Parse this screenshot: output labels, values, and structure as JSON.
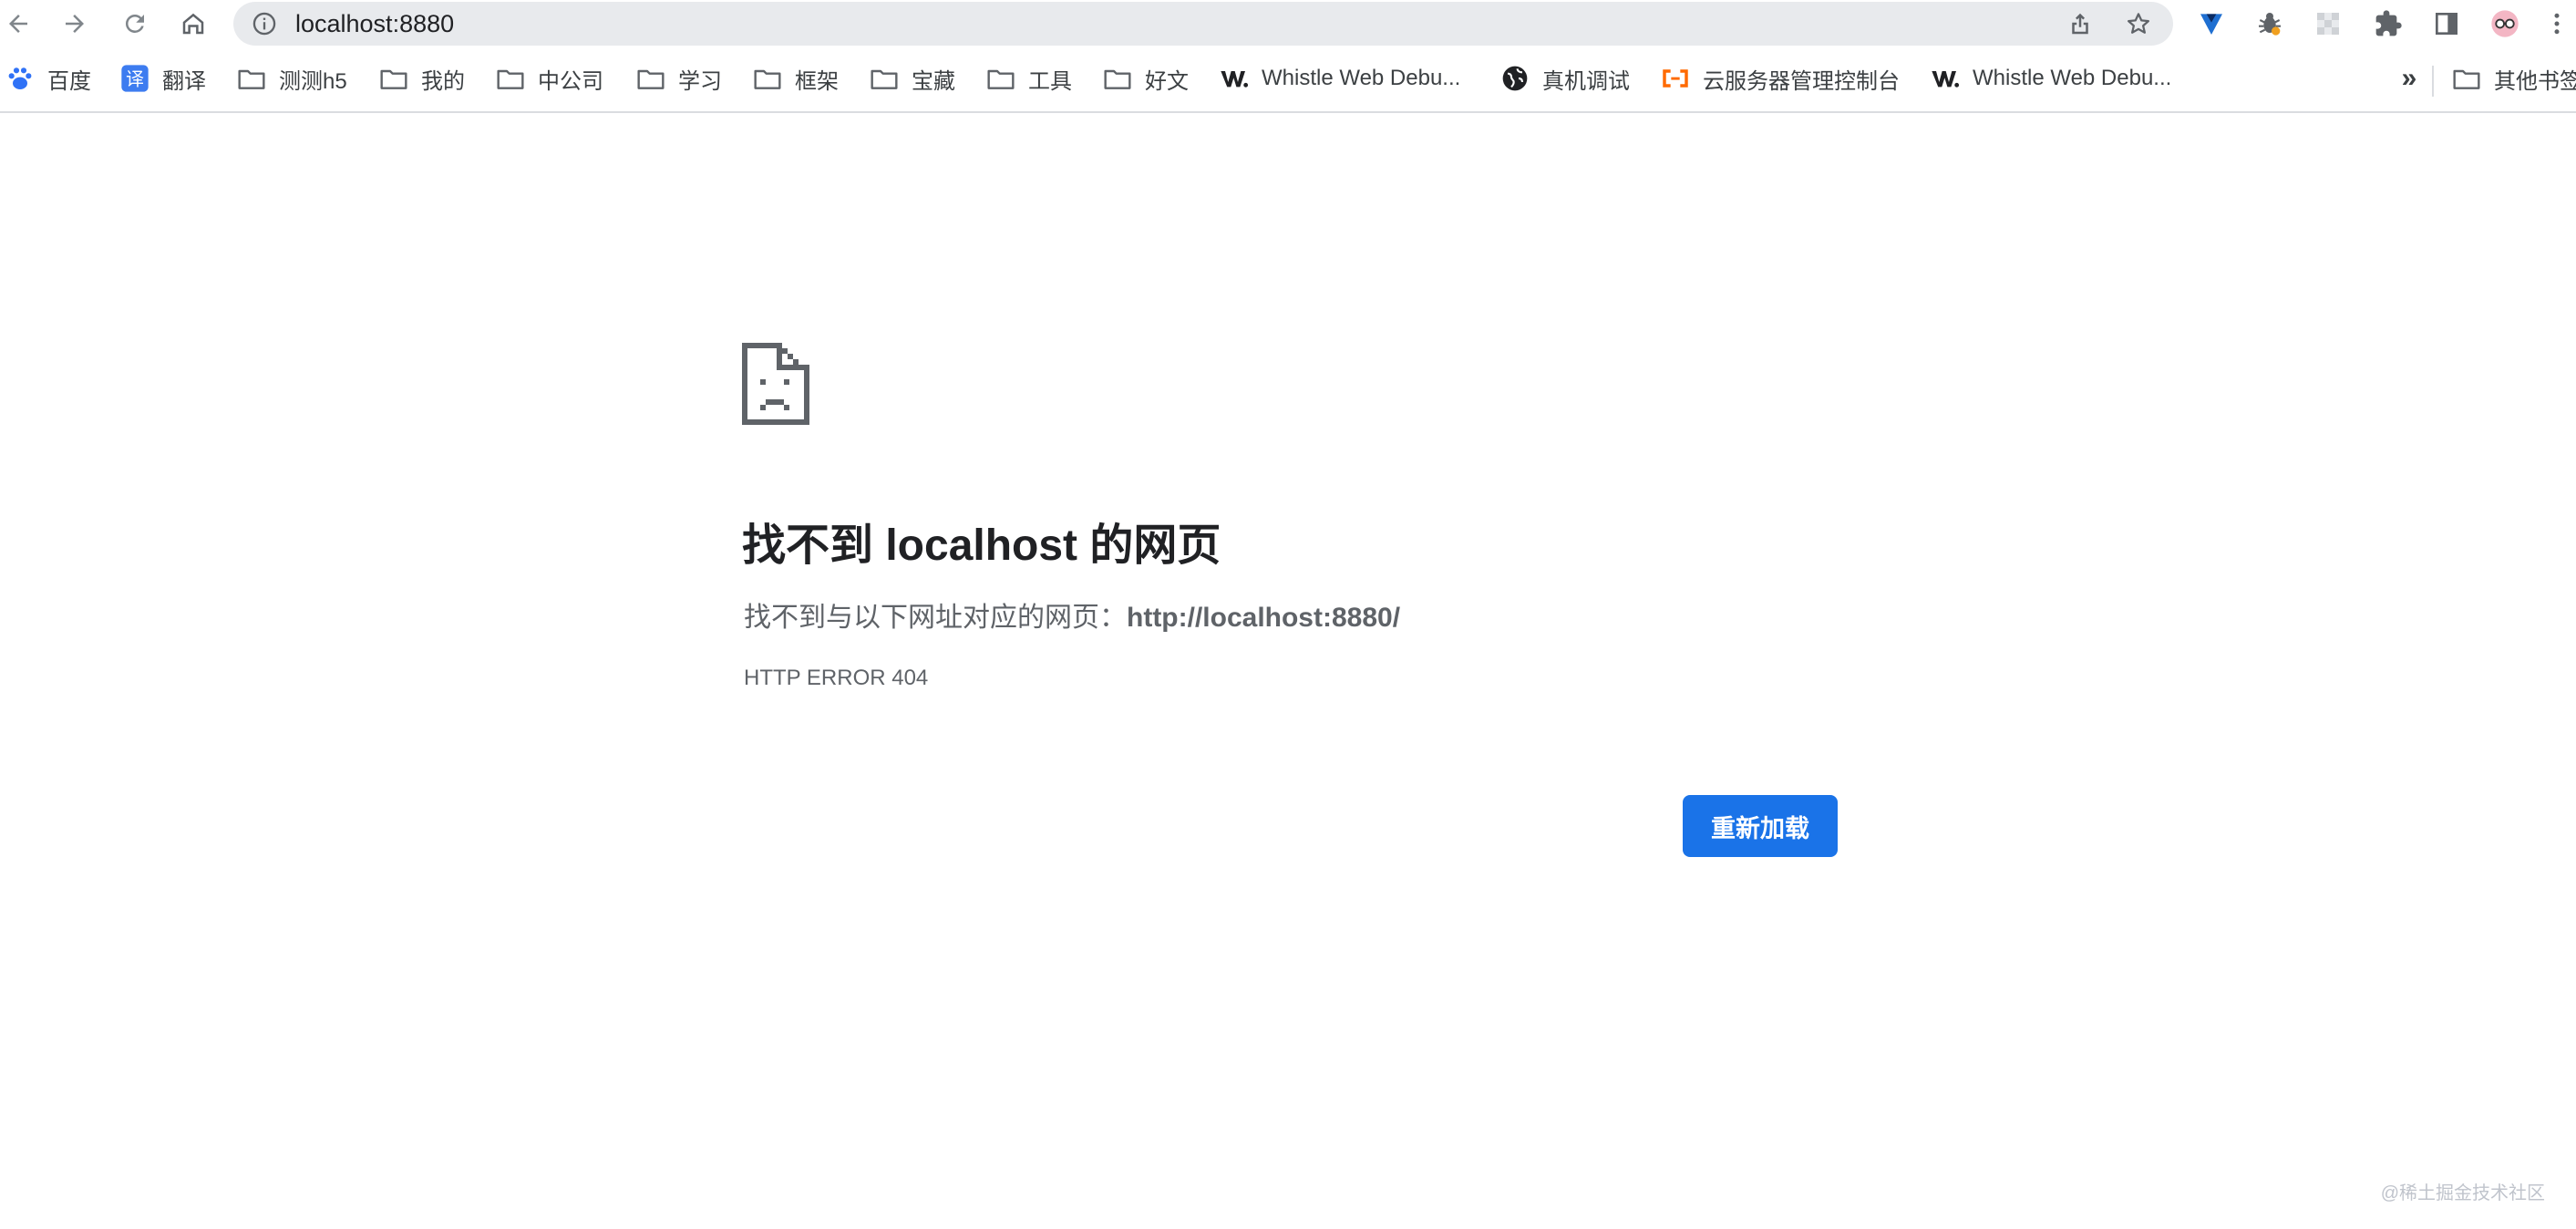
{
  "toolbar": {
    "back_icon": "back-arrow-icon",
    "forward_icon": "forward-arrow-icon",
    "reload_icon": "reload-icon",
    "home_icon": "home-icon",
    "url": "localhost:8880",
    "share_icon": "share-icon",
    "bookmark_star_icon": "star-icon",
    "extensions": [
      "vue-devtools-icon",
      "bug-extension-icon",
      "checker-extension-icon",
      "puzzle-icon",
      "side-panel-icon",
      "profile-avatar-icon",
      "more-menu-icon"
    ]
  },
  "bookmarks": {
    "items": [
      {
        "label": "百度",
        "icon": "baidu-paw-icon"
      },
      {
        "label": "翻译",
        "icon": "translate-icon",
        "icon_text": "译"
      },
      {
        "label": "测测h5",
        "icon": "folder-icon"
      },
      {
        "label": "我的",
        "icon": "folder-icon"
      },
      {
        "label": "中公司",
        "icon": "folder-icon"
      },
      {
        "label": "学习",
        "icon": "folder-icon"
      },
      {
        "label": "框架",
        "icon": "folder-icon"
      },
      {
        "label": "宝藏",
        "icon": "folder-icon"
      },
      {
        "label": "工具",
        "icon": "folder-icon"
      },
      {
        "label": "好文",
        "icon": "folder-icon"
      },
      {
        "label": "Whistle Web Debu...",
        "icon": "whistle-icon"
      },
      {
        "label": "真机调试",
        "icon": "globe-icon"
      },
      {
        "label": "云服务器管理控制台",
        "icon": "aliyun-icon"
      },
      {
        "label": "Whistle Web Debu...",
        "icon": "whistle-icon"
      }
    ],
    "more_label": "»",
    "other_label": "其他书签"
  },
  "error": {
    "icon": "sad-document-icon",
    "title": "找不到 localhost 的网页",
    "desc_prefix": "找不到与以下网址对应的网页：",
    "desc_url": "http://localhost:8880/",
    "code": "HTTP ERROR 404",
    "reload_label": "重新加载"
  },
  "watermark": "@稀土掘金技术社区",
  "colors": {
    "accent": "#1a73e8",
    "omnibox_bg": "#e8eaed",
    "text_primary": "#202124",
    "text_secondary": "#5f6368"
  }
}
